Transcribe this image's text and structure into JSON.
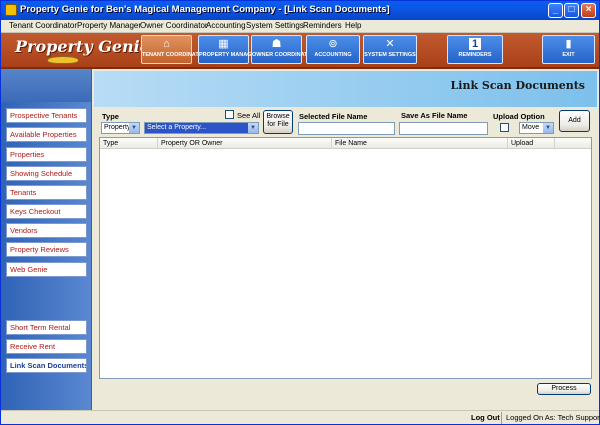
{
  "window": {
    "title": "Property Genie for Ben's Magical Management Company - [Link Scan Documents]",
    "min_glyph": "_",
    "max_glyph": "□",
    "close_glyph": "×"
  },
  "menu": [
    "Tenant Coordinator",
    "Property Manager",
    "Owner Coordinator",
    "Accounting",
    "System Settings",
    "Reminders",
    "Help"
  ],
  "logo": {
    "text": "Property Genie"
  },
  "toolbar": [
    {
      "label": "TENANT COORDINATOR",
      "icon": "house-icon",
      "glyph": "⌂"
    },
    {
      "label": "PROPERTY MANAGER",
      "icon": "building-icon",
      "glyph": "▦"
    },
    {
      "label": "OWNER COORDINATOR",
      "icon": "owner-icon",
      "glyph": "☗"
    },
    {
      "label": "ACCOUNTING",
      "icon": "coins-icon",
      "glyph": "⊚"
    },
    {
      "label": "SYSTEM SETTINGS",
      "icon": "tools-icon",
      "glyph": "✕"
    },
    {
      "label": "REMINDERS",
      "icon": "calendar-icon",
      "glyph": "1"
    },
    {
      "label": "EXIT",
      "icon": "door-icon",
      "glyph": "▮"
    }
  ],
  "sidebar": {
    "items": [
      "Prospective Tenants",
      "Available Properties",
      "Properties",
      "Showing Schedule",
      "Tenants",
      "Keys Checkout",
      "Vendors",
      "Property Reviews",
      "Web Genie"
    ],
    "bottom_items": [
      "Short Term Rental",
      "Receive Rent",
      "Link Scan Documents"
    ]
  },
  "page": {
    "title": "Link Scan Documents",
    "type_label": "Type",
    "type_value": "Property",
    "see_all_label": "See All",
    "property_select_value": "Select a Property...",
    "browse_button": "Browse for File",
    "selected_file_label": "Selected File Name",
    "selected_file_value": "",
    "save_as_label": "Save As File Name",
    "save_as_value": "",
    "upload_option_label": "Upload Option",
    "upload_option_value": "Move",
    "add_button": "Add",
    "grid_columns": [
      "Type",
      "Property OR Owner",
      "File Name",
      "Upload"
    ],
    "process_button": "Process"
  },
  "status": {
    "logout": "Log Out",
    "logged_on": "Logged On As: Tech Support"
  }
}
